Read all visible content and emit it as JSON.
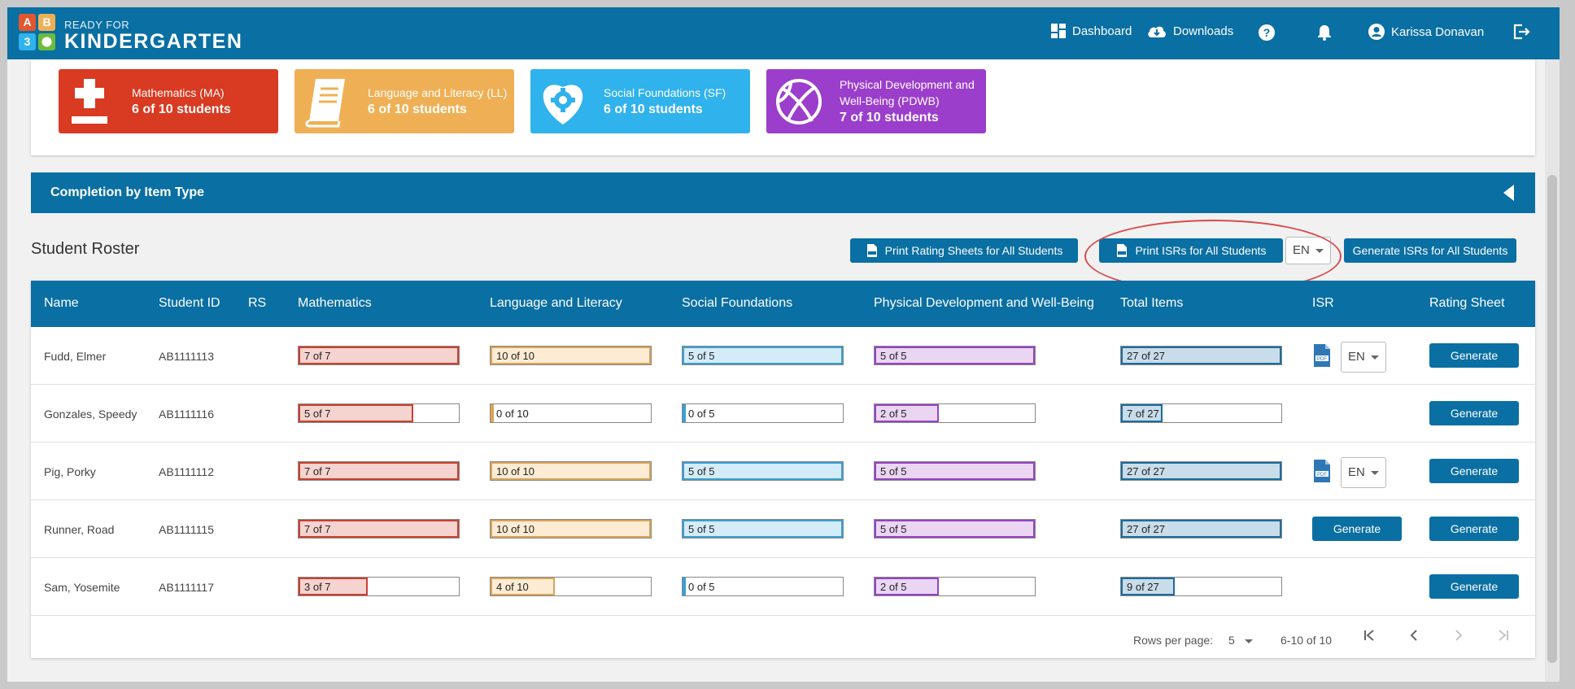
{
  "header": {
    "brand_small": "READY FOR",
    "brand_big": "KINDERGARTEN",
    "logo_letters": [
      "A",
      "B",
      "3",
      ""
    ],
    "nav": {
      "dashboard": "Dashboard",
      "downloads": "Downloads",
      "user": "Karissa Donavan"
    }
  },
  "domain_cards": [
    {
      "title": "Mathematics (MA)",
      "value": "6 of 10 students",
      "color": "#d93a22"
    },
    {
      "title": "Language and Literacy (LL)",
      "value": "6 of 10 students",
      "color": "#efb055"
    },
    {
      "title": "Social Foundations (SF)",
      "value": "6 of 10 students",
      "color": "#30b2ec"
    },
    {
      "title_line1": "Physical Development and",
      "title_line2": "Well-Being (PDWB)",
      "value": "7 of 10 students",
      "color": "#9b3ecb"
    }
  ],
  "completion_section": {
    "label": "Completion by Item Type"
  },
  "roster": {
    "title": "Student Roster",
    "print_rating_sheets": "Print Rating Sheets for All Students",
    "print_isrs": "Print ISRs for All Students",
    "language": "EN",
    "generate_isrs": "Generate ISRs for All Students"
  },
  "table": {
    "columns": [
      "Name",
      "Student ID",
      "RS",
      "Mathematics",
      "Language and Literacy",
      "Social Foundations",
      "Physical Development and Well-Being",
      "Total Items",
      "ISR",
      "Rating Sheet"
    ],
    "rows": [
      {
        "name": "Fudd, Elmer",
        "id": "AB1111113",
        "math": "7 of 7",
        "lang": "10 of 10",
        "social": "5 of 5",
        "phys": "5 of 5",
        "total": "27 of 27",
        "isr": "pdf",
        "isr_lang": "EN",
        "rating": "Generate"
      },
      {
        "name": "Gonzales, Speedy",
        "id": "AB1111116",
        "math": "5 of 7",
        "lang": "0 of 10",
        "social": "0 of 5",
        "phys": "2 of 5",
        "total": "7 of 27",
        "isr": "none",
        "rating": "Generate"
      },
      {
        "name": "Pig, Porky",
        "id": "AB1111112",
        "math": "7 of 7",
        "lang": "10 of 10",
        "social": "5 of 5",
        "phys": "5 of 5",
        "total": "27 of 27",
        "isr": "pdf",
        "isr_lang": "EN",
        "rating": "Generate"
      },
      {
        "name": "Runner, Road",
        "id": "AB1111115",
        "math": "7 of 7",
        "lang": "10 of 10",
        "social": "5 of 5",
        "phys": "5 of 5",
        "total": "27 of 27",
        "isr": "button",
        "isr_label": "Generate",
        "rating": "Generate"
      },
      {
        "name": "Sam, Yosemite",
        "id": "AB1111117",
        "math": "3 of 7",
        "lang": "4 of 10",
        "social": "0 of 5",
        "phys": "2 of 5",
        "total": "9 of 27",
        "isr": "none",
        "rating": "Generate"
      }
    ]
  },
  "bar_colors": {
    "math": {
      "border": "#c9412f",
      "fill": "#f5d3cf"
    },
    "lang": {
      "border": "#d9a458",
      "fill": "#fdecd3"
    },
    "social": {
      "border": "#3a9fd1",
      "fill": "#d4ecf8"
    },
    "phys": {
      "border": "#9543c4",
      "fill": "#ead5f3"
    },
    "total": {
      "border": "#1b6d9c",
      "fill": "#c9dce9"
    }
  },
  "pagination": {
    "rows_per_page_label": "Rows per page:",
    "rows_per_page": "5",
    "range": "6-10 of 10"
  }
}
